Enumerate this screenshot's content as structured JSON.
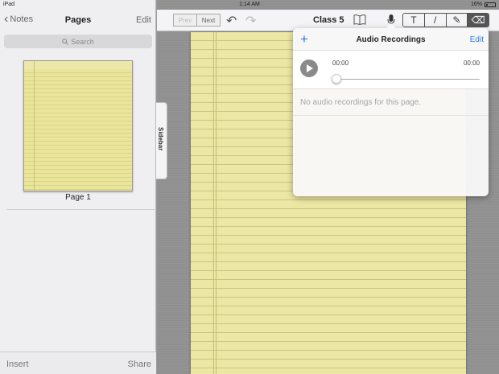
{
  "status_bar": {
    "device": "iPad",
    "time": "1:14 AM",
    "battery": "16%"
  },
  "sidebar": {
    "back_label": "Notes",
    "title": "Pages",
    "edit_label": "Edit",
    "search_placeholder": "Search",
    "page_label": "Page 1",
    "insert_label": "Insert",
    "share_label": "Share",
    "tab_label": "Sidebar"
  },
  "toolbar": {
    "prev_label": "Prev",
    "next_label": "Next",
    "doc_title": "Class 5",
    "tools": [
      {
        "icon": "text-tool-icon",
        "glyph": "T"
      },
      {
        "icon": "pen-tool-icon",
        "glyph": "/"
      },
      {
        "icon": "highlighter-tool-icon",
        "glyph": "✎"
      },
      {
        "icon": "eraser-tool-icon",
        "glyph": "⌫"
      }
    ]
  },
  "popover": {
    "title": "Audio Recordings",
    "edit_label": "Edit",
    "time_start": "00:00",
    "time_end": "00:00",
    "progress": 0,
    "empty_message": "No audio recordings for this page."
  },
  "colors": {
    "accent": "#2c7be5",
    "paper": "#ece7a2"
  }
}
